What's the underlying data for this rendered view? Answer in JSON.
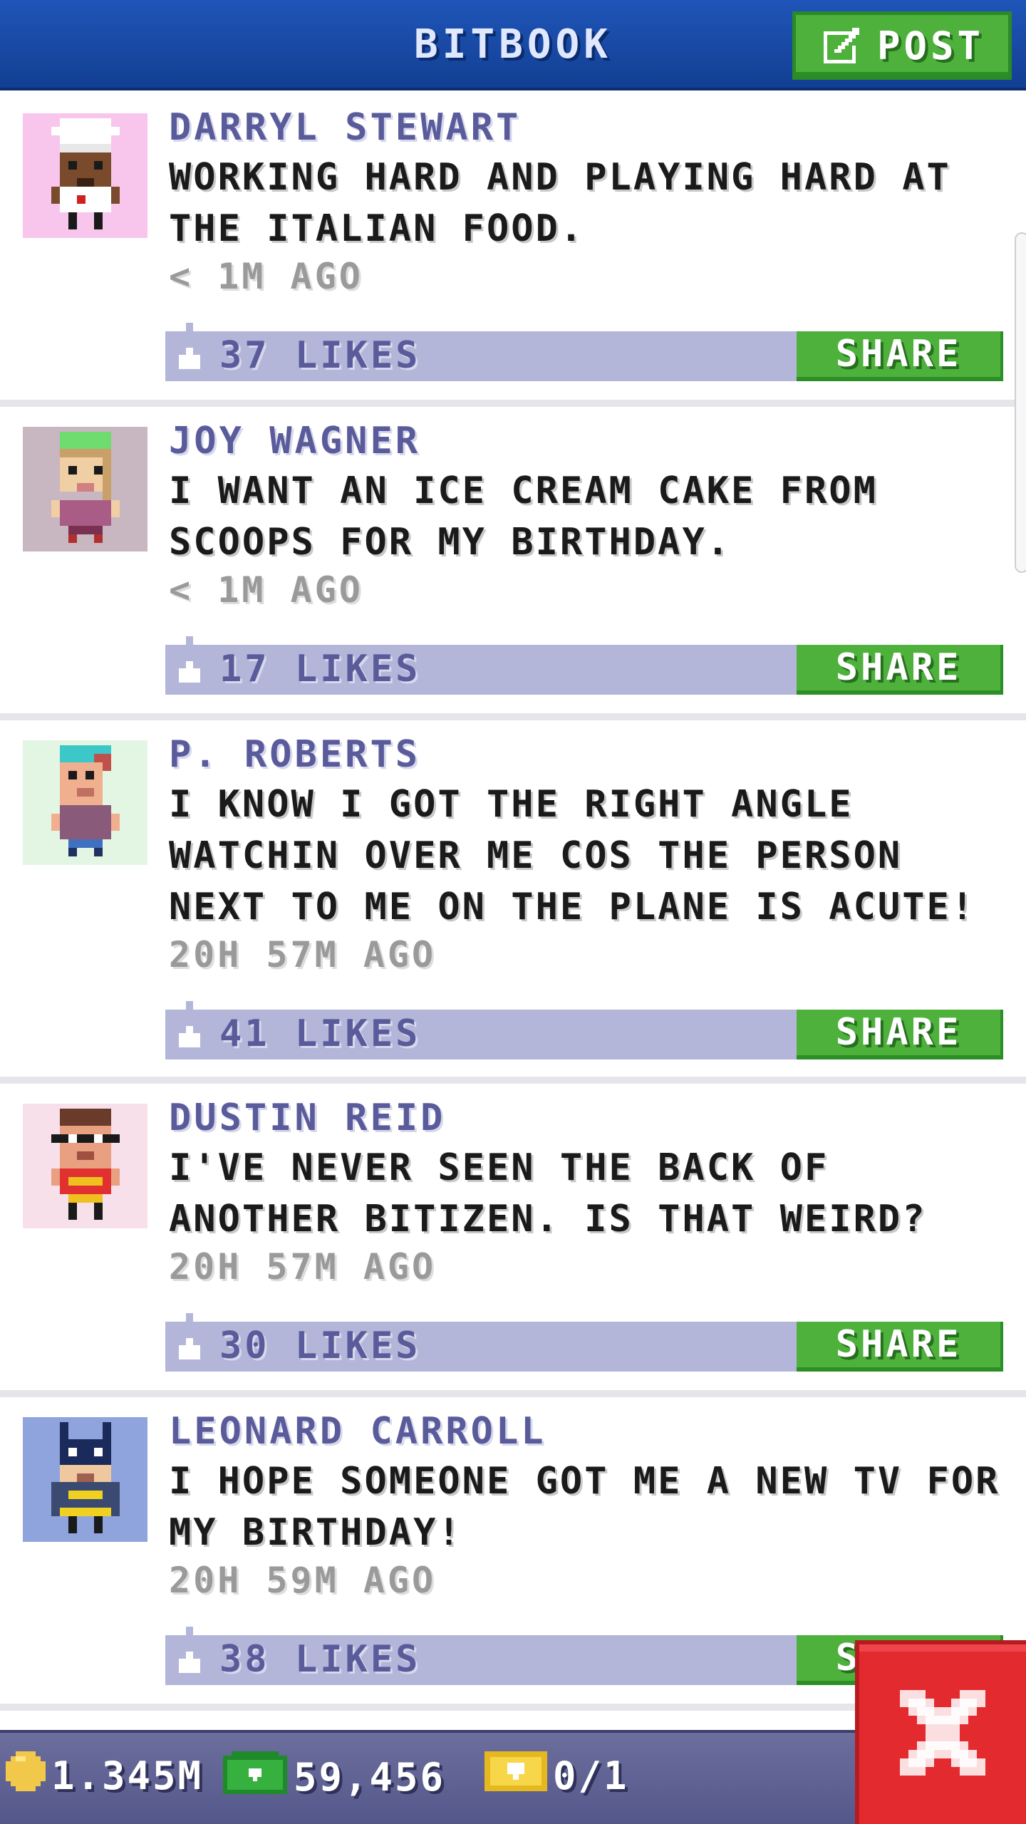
{
  "header": {
    "title": "BITBOOK",
    "post_label": "POST"
  },
  "posts": [
    {
      "author": "DARRYL STEWART",
      "message": "WORKING HARD AND PLAYING HARD AT THE ITALIAN FOOD.",
      "time": "< 1M AGO",
      "likes": "37 LIKES",
      "share": "SHARE",
      "avatar_bg": "#f8c6ec"
    },
    {
      "author": "JOY WAGNER",
      "message": "I WANT AN ICE CREAM CAKE FROM SCOOPS FOR MY BIRTHDAY.",
      "time": "< 1M AGO",
      "likes": "17 LIKES",
      "share": "SHARE",
      "avatar_bg": "#c8b6c0"
    },
    {
      "author": "P. ROBERTS",
      "message": "I KNOW I GOT THE RIGHT ANGLE WATCHIN OVER ME COS THE PERSON NEXT TO ME ON THE PLANE IS ACUTE!",
      "time": "20H 57M AGO",
      "likes": "41 LIKES",
      "share": "SHARE",
      "avatar_bg": "#e3f6e3"
    },
    {
      "author": "DUSTIN REID",
      "message": "I'VE NEVER SEEN THE BACK OF ANOTHER BITIZEN. IS THAT WEIRD?",
      "time": "20H 57M AGO",
      "likes": "30 LIKES",
      "share": "SHARE",
      "avatar_bg": "#f8e0ea"
    },
    {
      "author": "LEONARD CARROLL",
      "message": "I HOPE SOMEONE GOT ME A NEW TV FOR MY BIRTHDAY!",
      "time": "20H 59M AGO",
      "likes": "38 LIKES",
      "share": "SHARE",
      "avatar_bg": "#8fa3dd"
    }
  ],
  "status": {
    "coins": "1.345M",
    "bux": "59,456",
    "tickets": "0/1"
  },
  "colors": {
    "header": "#1f55b8",
    "green": "#4db13c",
    "likebar": "#b3b6d9",
    "author": "#5a5b9a",
    "close": "#e32a2f"
  },
  "icons": {
    "post": "edit-icon",
    "like": "thumbs-up-icon",
    "coin": "coin-icon",
    "bux": "cash-icon",
    "ticket": "ticket-icon",
    "close": "close-icon"
  }
}
